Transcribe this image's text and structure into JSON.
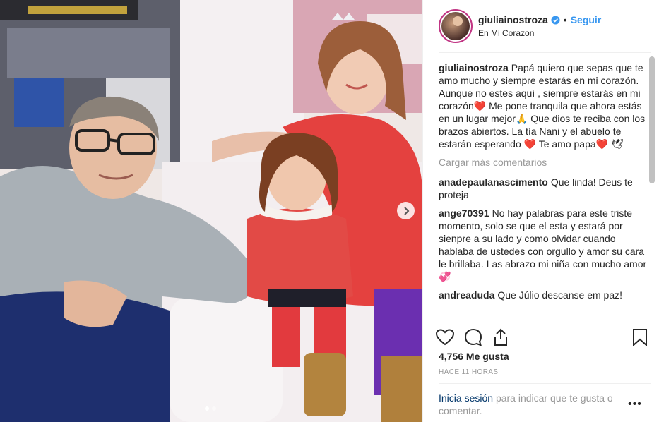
{
  "post": {
    "username": "giuliainostroza",
    "follow_label": "Seguir",
    "separator": "•",
    "location": "En Mi Corazon"
  },
  "caption": {
    "username": "giuliainostroza",
    "text": "Papá quiero que sepas que te amo mucho y siempre estarás en mi corazón. Aunque no estes aquí , siempre estarás en mi corazón❤️ Me pone tranquila que ahora estás en un lugar mejor🙏 Que dios te reciba con los brazos abiertos. La tía Nani y el abuelo te estarán esperando ❤️ Te amo papa❤️ 🕊"
  },
  "load_more_label": "Cargar más comentarios",
  "comments": [
    {
      "username": "anadepaulanascimento",
      "text": "Que linda! Deus te proteja"
    },
    {
      "username": "ange70391",
      "text": "No hay palabras para este triste momento, solo se que el esta y estará por sienpre a su lado y como olvidar cuando hablaba de ustedes con orgullo y amor su cara le brillaba. Las abrazo mi niña con mucho amor 💞"
    },
    {
      "username": "andreaduda",
      "text": "Que Júlio descanse em paz!"
    }
  ],
  "likes_label": "4,756 Me gusta",
  "timestamp": "HACE 11 HORAS",
  "login": {
    "link_label": "Inicia sesión",
    "rest": "para indicar que te gusta o comentar."
  },
  "more_options_label": "•••",
  "icons": {
    "verified": "verified-badge-icon",
    "like": "heart-outline-icon",
    "comment": "speech-bubble-icon",
    "share": "share-upload-icon",
    "save": "bookmark-icon",
    "next": "chevron-right-icon",
    "more": "more-options-icon"
  },
  "colors": {
    "link_blue": "#3897f0",
    "login_link": "#003569",
    "muted": "#999999",
    "text": "#262626",
    "avatar_ring": "#c13584"
  },
  "carousel": {
    "slides": 2,
    "active_index": 0
  }
}
